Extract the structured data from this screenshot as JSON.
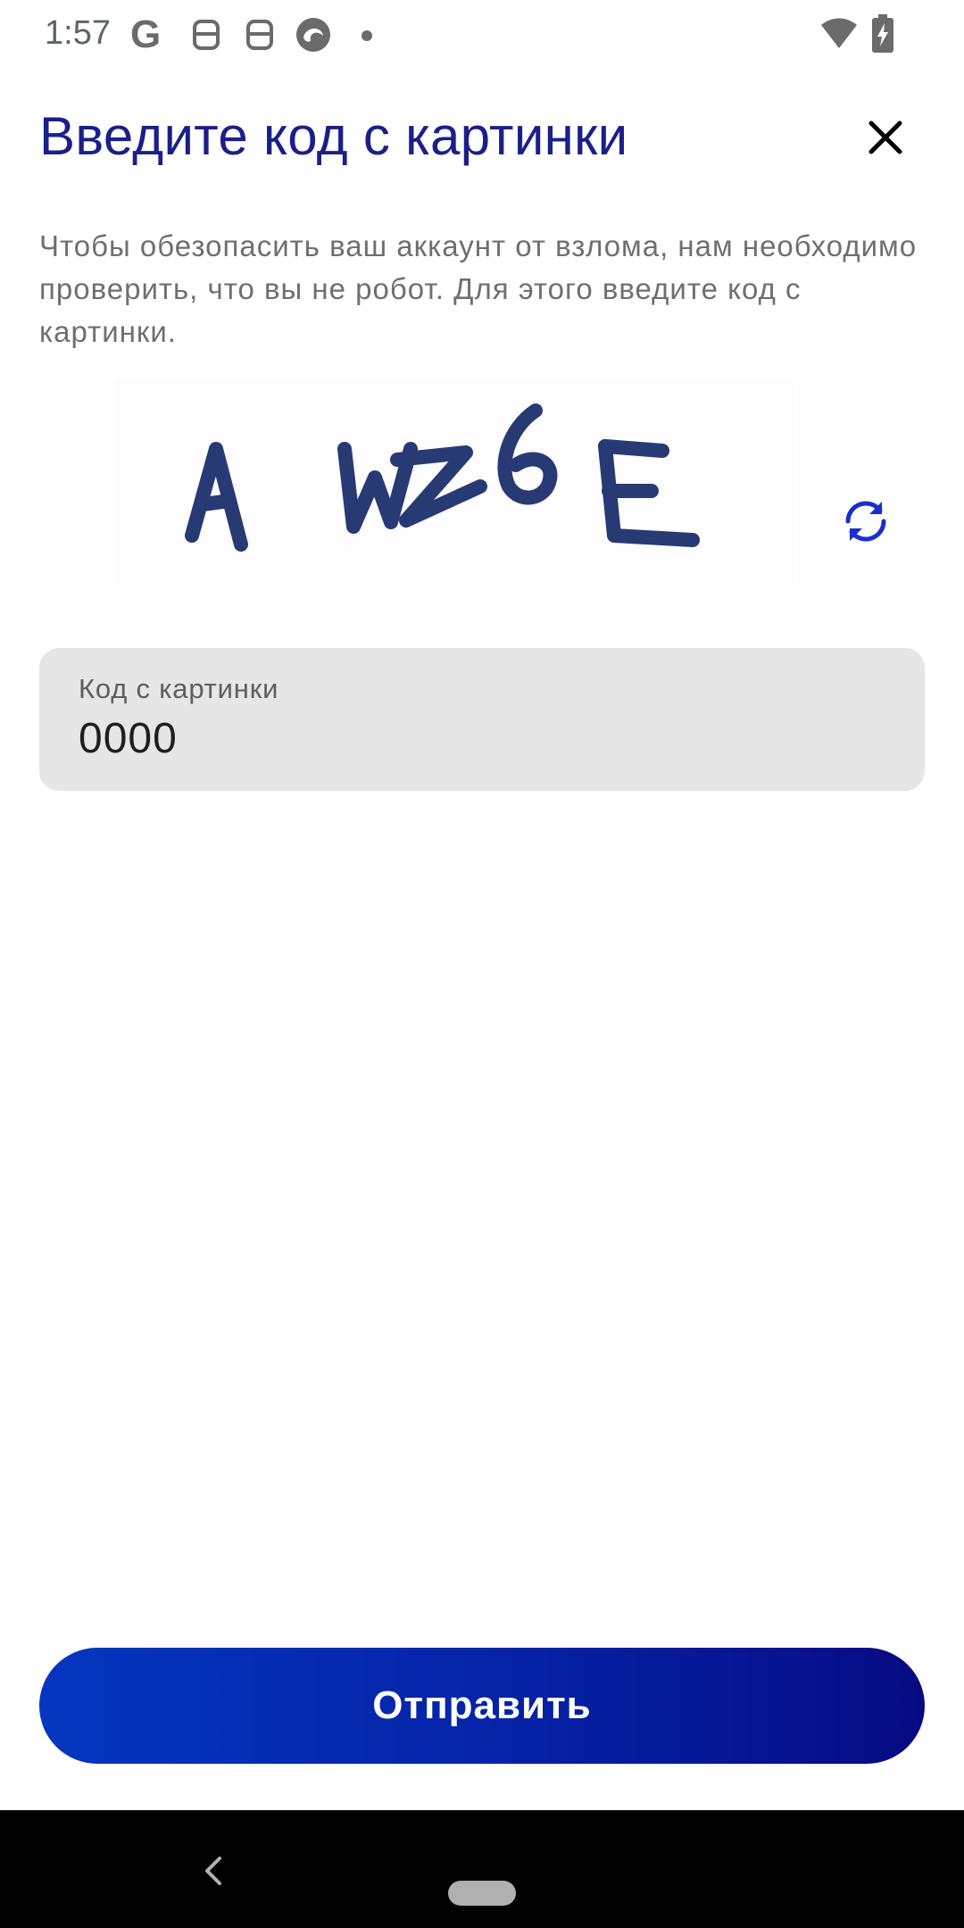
{
  "status_bar": {
    "time": "1:57",
    "icons": [
      "google-icon",
      "notification-s-icon",
      "notification-s-icon",
      "edge-icon",
      "notification-dot",
      "wifi-icon",
      "battery-charging-icon"
    ]
  },
  "dialog": {
    "title": "Введите код с картинки",
    "close_icon": "close-icon",
    "description": "Чтобы обезопасить ваш аккаунт от взлома, нам необходимо проверить, что вы не робот. Для этого введите код с картинки.",
    "captcha": {
      "characters": [
        "A",
        "W",
        "Z",
        "6",
        "E"
      ],
      "refresh_icon": "refresh-icon"
    },
    "code_field": {
      "label": "Код с картинки",
      "value": "0000"
    },
    "submit_label": "Отправить"
  },
  "colors": {
    "title": "#1a1f8a",
    "accent": "#1a2fd0",
    "button_gradient_start": "#0536c0",
    "button_gradient_end": "#060a82",
    "field_background": "#e6e6e6"
  },
  "nav_bar": {
    "icons": [
      "back-icon",
      "home-pill"
    ]
  }
}
